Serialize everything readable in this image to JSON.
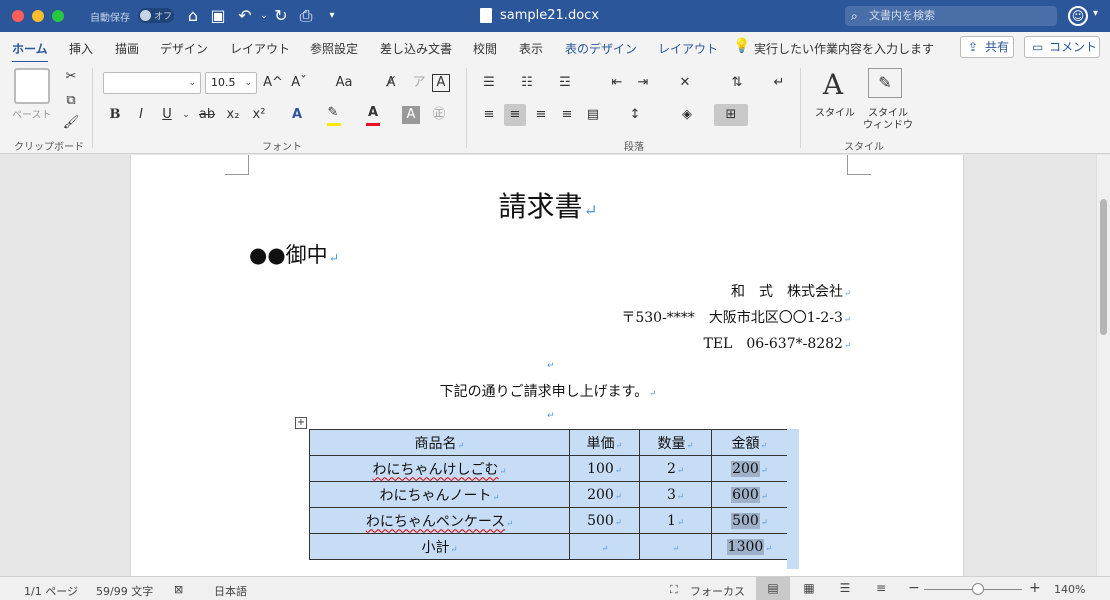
{
  "titlebar": {
    "autosave_label": "自動保存",
    "autosave_state": "オフ",
    "doc_name": "sample21.docx",
    "search_placeholder": "文書内を検索"
  },
  "tabs": [
    {
      "label": "ホーム",
      "active": true
    },
    {
      "label": "挿入"
    },
    {
      "label": "描画"
    },
    {
      "label": "デザイン"
    },
    {
      "label": "レイアウト"
    },
    {
      "label": "参照設定"
    },
    {
      "label": "差し込み文書"
    },
    {
      "label": "校閲"
    },
    {
      "label": "表示"
    },
    {
      "label": "表のデザイン",
      "contextual": true
    },
    {
      "label": "レイアウト",
      "contextual": true
    }
  ],
  "tell_me": "実行したい作業内容を入力します",
  "share_label": "共有",
  "comment_label": "コメント",
  "ribbon": {
    "paste_label": "ペースト",
    "clipboard_group": "クリップボード",
    "font_group": "フォント",
    "paragraph_group": "段落",
    "styles_group": "スタイル",
    "font_name": "",
    "font_size": "10.5",
    "grow_font": "A^",
    "shrink_font": "Aˇ",
    "change_case": "Aa",
    "styles_btn": "スタイル",
    "styles_pane_line1": "スタイル",
    "styles_pane_line2": "ウィンドウ"
  },
  "document": {
    "title": "請求書",
    "addressee": "●●御中",
    "sender_company": "和　式　株式会社",
    "sender_address": "〒530-****　大阪市北区〇〇1-2-3",
    "sender_tel": "TEL　06-637*-8282",
    "intro": "下記の通りご請求申し上げます。",
    "table": {
      "headers": [
        "商品名",
        "単価",
        "数量",
        "金額"
      ],
      "rows": [
        [
          "わにちゃんけしごむ",
          "100",
          "2",
          "200"
        ],
        [
          "わにちゃんノート",
          "200",
          "3",
          "600"
        ],
        [
          "わにちゃんペンケース",
          "500",
          "1",
          "500"
        ],
        [
          "小計",
          "",
          "",
          "1300"
        ]
      ]
    }
  },
  "status": {
    "page": "1/1 ページ",
    "words": "59/99 文字",
    "language": "日本語",
    "focus": "フォーカス",
    "zoom": "140%"
  }
}
